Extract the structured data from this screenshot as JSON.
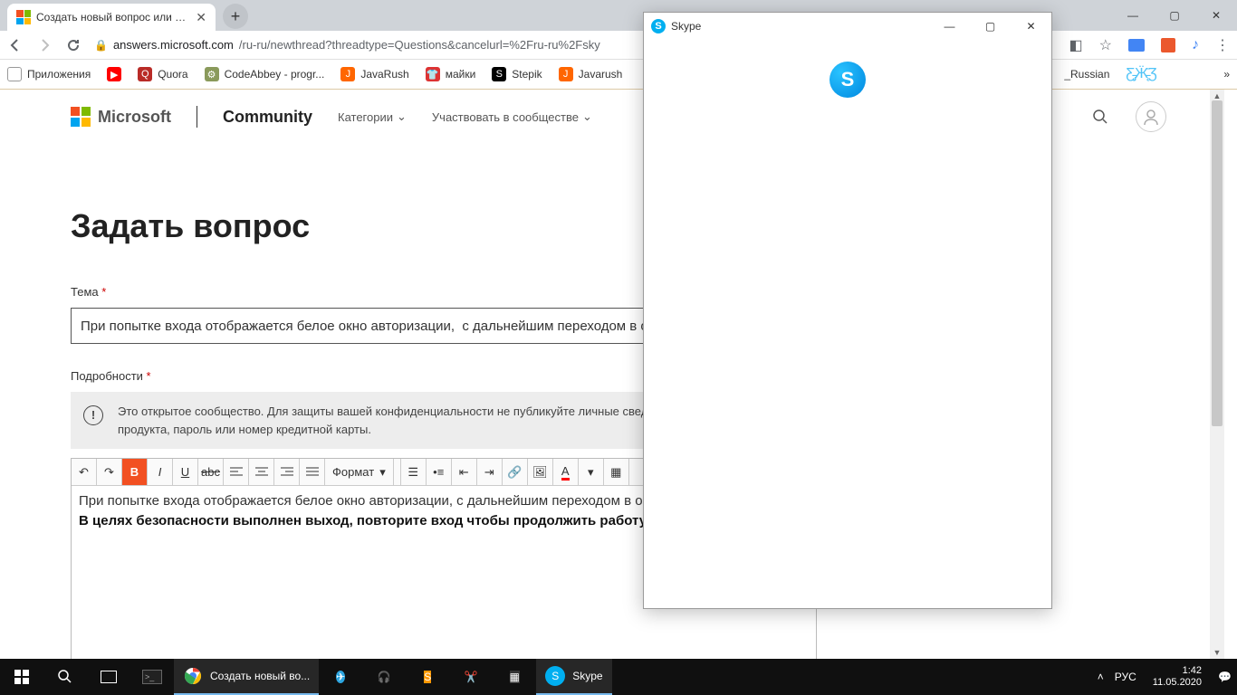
{
  "browser": {
    "tab_title": "Создать новый вопрос или нач",
    "url_host": "answers.microsoft.com",
    "url_path": "/ru-ru/newthread?threadtype=Questions&cancelurl=%2Fru-ru%2Fsky"
  },
  "bookmarks": {
    "apps": "Приложения",
    "quora": "Quora",
    "codeabbey": "CodeAbbey - progr...",
    "javarush1": "JavaRush",
    "maiki": "майки",
    "stepik": "Stepik",
    "javarush2": "Javarush",
    "russian": "_Russian"
  },
  "ms": {
    "brand": "Microsoft",
    "community": "Community",
    "nav_categories": "Категории",
    "nav_participate": "Участвовать в сообществе"
  },
  "form": {
    "heading": "Задать вопрос",
    "subject_label": "Тема",
    "subject_value": "При попытке входа отображается белое окно авторизации,  с дальнейшим переходом в ок",
    "details_label": "Подробности",
    "warning_text": "Это открытое сообщество. Для защиты вашей конфиденциальности не публикуйте личные сведения, телефона, ключ продукта, пароль или номер кредитной карты.",
    "format_label": "Формат",
    "body_line1": "При попытке входа отображается белое окно авторизации,  с дальнейшим переходом в окн",
    "body_line2": "В целях безопасности выполнен выход, повторите вход чтобы продолжить работу."
  },
  "skype": {
    "title": "Skype",
    "logo_letter": "S"
  },
  "taskbar": {
    "chrome_label": "Создать новый во...",
    "skype_label": "Skype",
    "lang": "РУС",
    "time": "1:42",
    "date": "11.05.2020"
  }
}
